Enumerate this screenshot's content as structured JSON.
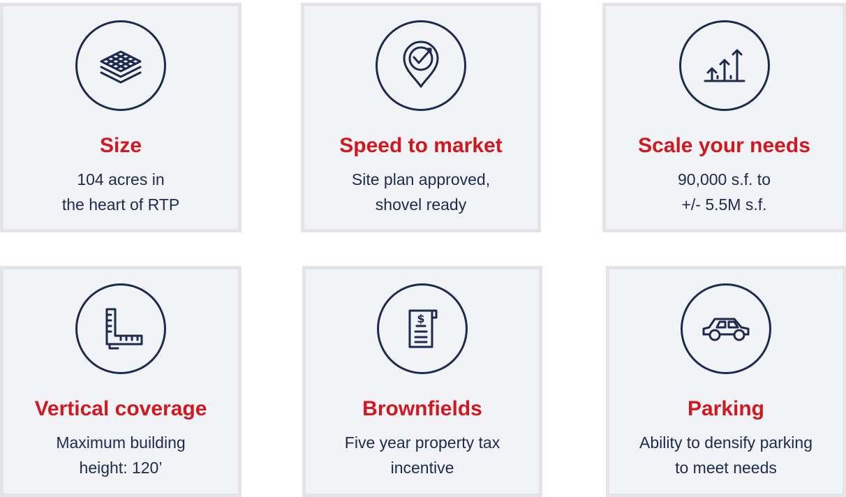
{
  "colors": {
    "title": "#d2171f",
    "text": "#1c2a4f",
    "icon": "#1c2a4f",
    "card_background": "#f2f3f6",
    "card_border": "#e3e4e8"
  },
  "cards": [
    {
      "icon": "layers-grid-icon",
      "title": "Size",
      "lines": [
        "104 acres in",
        "the heart of RTP"
      ]
    },
    {
      "icon": "target-pin-check-icon",
      "title": "Speed to market",
      "lines": [
        "Site plan approved,",
        "shovel ready"
      ]
    },
    {
      "icon": "growth-arrows-icon",
      "title": "Scale your needs",
      "lines": [
        "90,000 s.f. to",
        "+/- 5.5M s.f."
      ]
    },
    {
      "icon": "l-ruler-icon",
      "title": "Vertical coverage",
      "lines": [
        "Maximum building",
        "height: 120’"
      ]
    },
    {
      "icon": "tax-document-icon",
      "title": "Brownfields",
      "lines": [
        "Five year property tax",
        "incentive"
      ]
    },
    {
      "icon": "car-icon",
      "title": "Parking",
      "lines": [
        "Ability to densify parking",
        "to meet needs"
      ]
    }
  ]
}
